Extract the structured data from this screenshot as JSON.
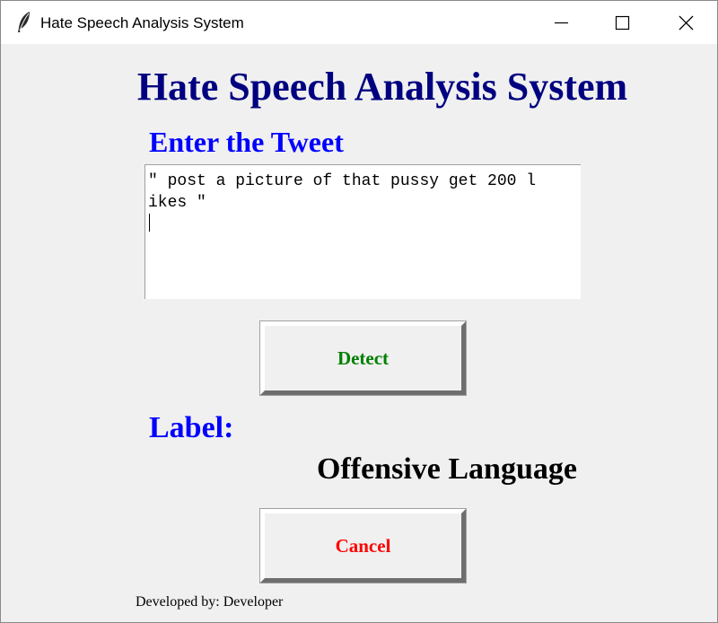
{
  "window": {
    "title": "Hate Speech Analysis System",
    "app_icon": "feather-icon",
    "controls": [
      "minimize-icon",
      "maximize-icon",
      "close-icon"
    ]
  },
  "main": {
    "heading": "Hate Speech Analysis System",
    "input_label": "Enter the Tweet",
    "tweet_value": "\" post a picture of that pussy get 200 l\nikes \"",
    "detect_label": "Detect",
    "result_heading": "Label:",
    "result_value": "Offensive Language",
    "cancel_label": "Cancel",
    "footer": "Developed by: Developer"
  },
  "colors": {
    "heading": "#000080",
    "label": "#0000ff",
    "detect": "#008000",
    "cancel": "#ff0000",
    "background": "#f0f0f0"
  }
}
